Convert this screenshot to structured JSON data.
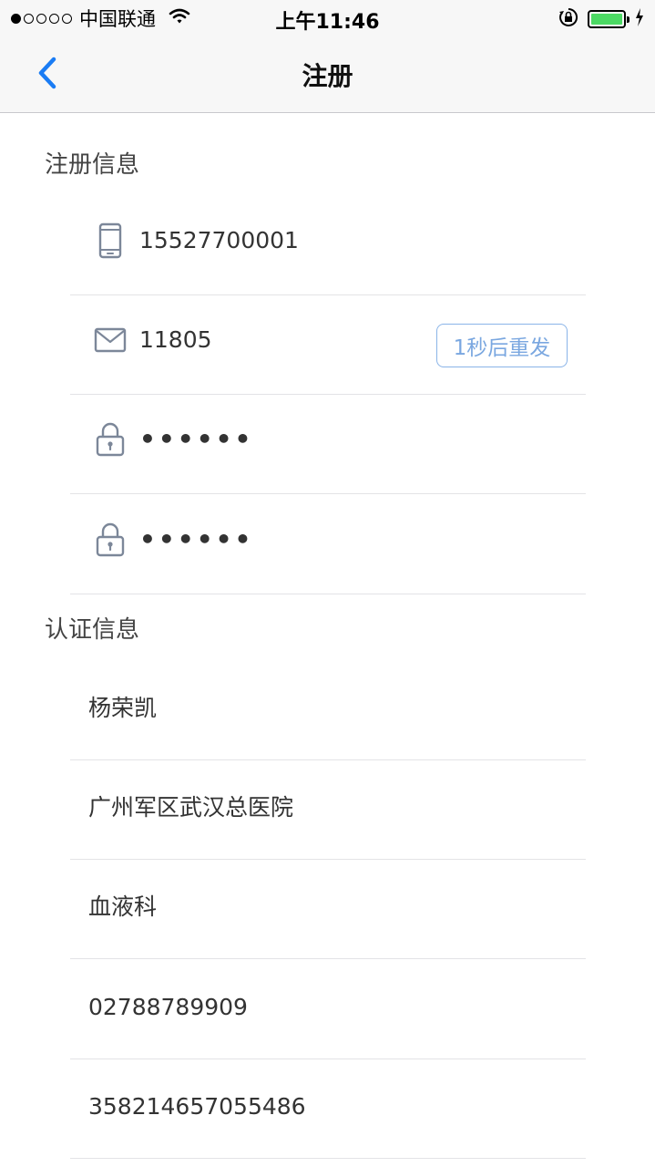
{
  "status_bar": {
    "signal_bars_filled": 1,
    "signal_bars_total": 5,
    "carrier": "中国联通",
    "time": "上午11:46",
    "battery_color": "#4cd964"
  },
  "nav": {
    "title": "注册",
    "back_icon": "chevron-left-icon",
    "accent_color": "#1a7cf4"
  },
  "registration": {
    "section_title": "注册信息",
    "phone": {
      "icon": "phone-icon",
      "value": "15527700001"
    },
    "code": {
      "icon": "mail-icon",
      "value": "11805",
      "resend_label": "1秒后重发"
    },
    "password": {
      "icon": "lock-icon",
      "value": "••••••"
    },
    "confirm_password": {
      "icon": "lock-icon",
      "value": "••••••"
    }
  },
  "certification": {
    "section_title": "认证信息",
    "items": [
      {
        "value": "杨荣凯"
      },
      {
        "value": "广州军区武汉总医院"
      },
      {
        "value": "血液科"
      },
      {
        "value": "02788789909"
      },
      {
        "value": "358214657055486"
      }
    ]
  }
}
